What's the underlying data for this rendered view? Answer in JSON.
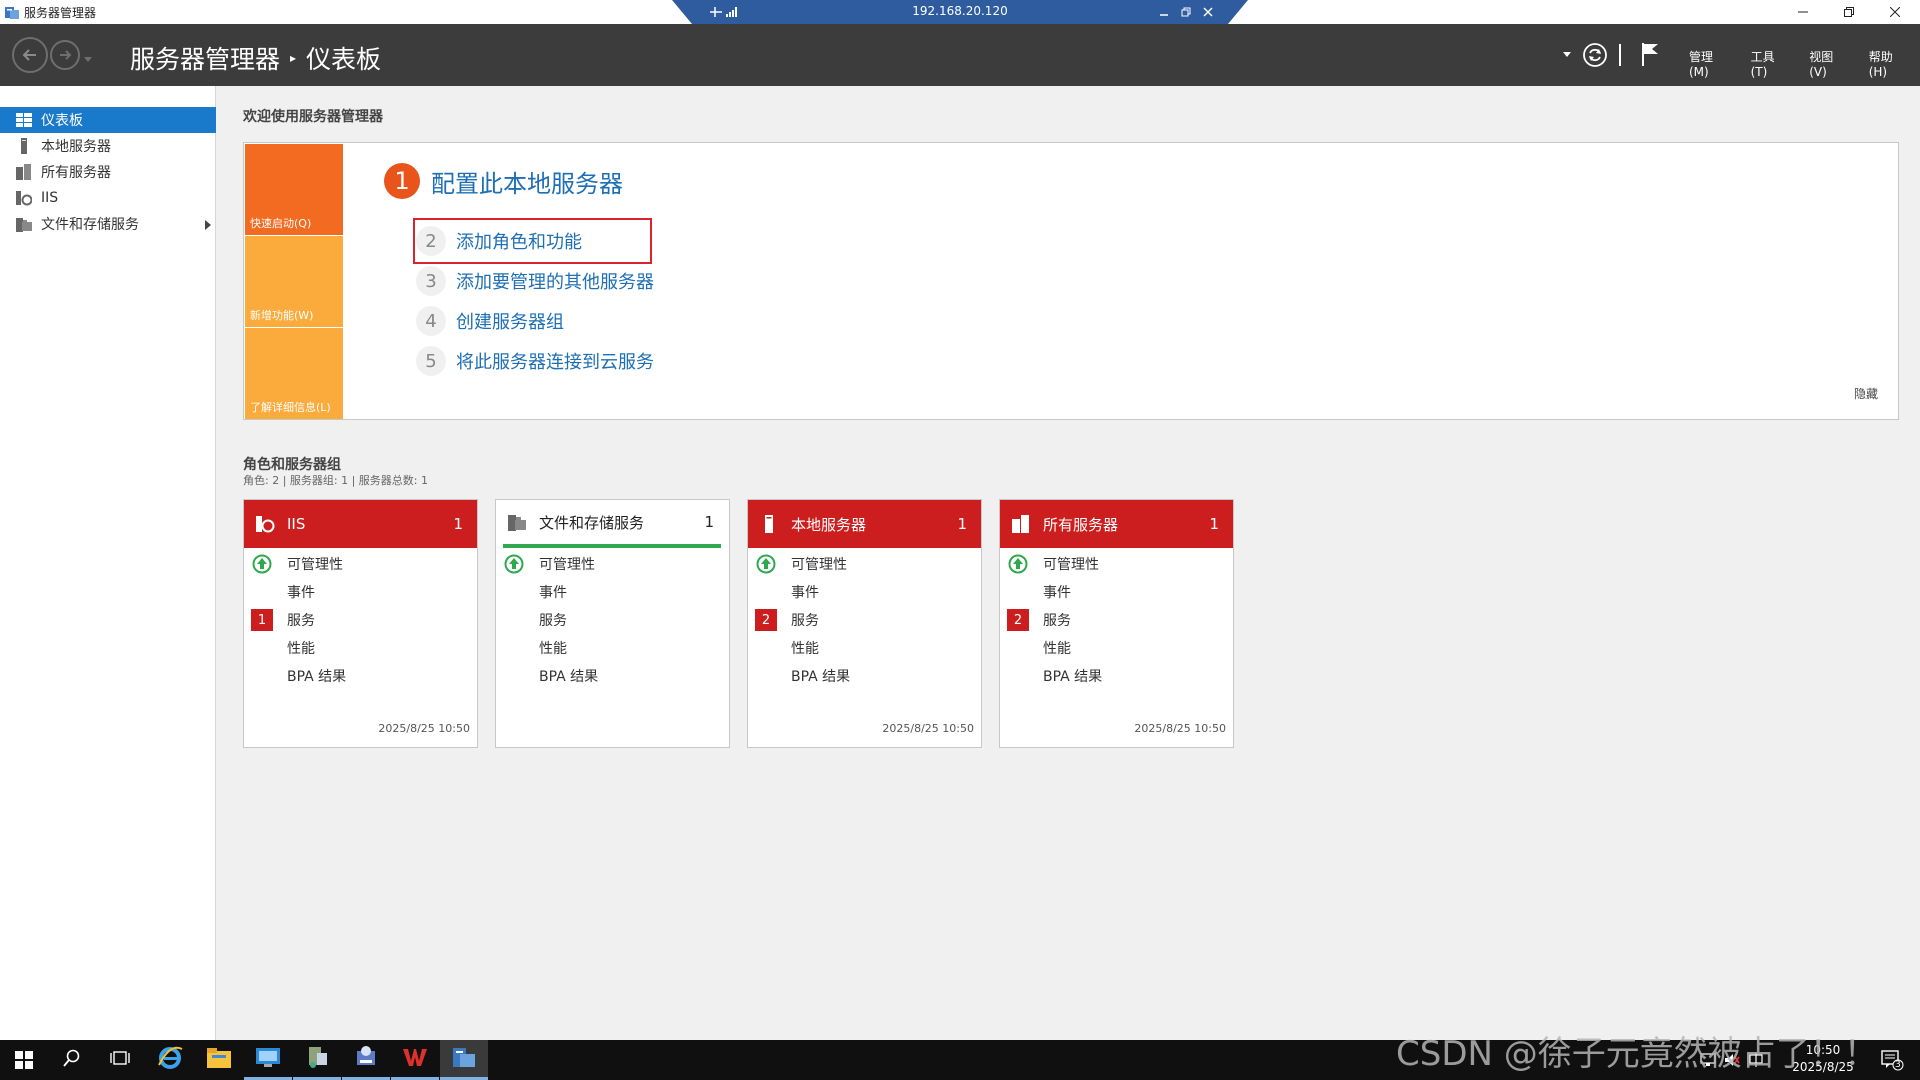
{
  "window": {
    "title": "服务器管理器",
    "rdp_host": "192.168.20.120"
  },
  "header": {
    "breadcrumb_app": "服务器管理器",
    "breadcrumb_page": "仪表板",
    "menu": [
      "管理(M)",
      "工具(T)",
      "视图(V)",
      "帮助(H)"
    ]
  },
  "sidebar": {
    "items": [
      {
        "label": "仪表板",
        "icon": "dashboard-icon",
        "active": true
      },
      {
        "label": "本地服务器",
        "icon": "local-server-icon",
        "active": false
      },
      {
        "label": "所有服务器",
        "icon": "all-servers-icon",
        "active": false
      },
      {
        "label": "IIS",
        "icon": "iis-icon",
        "active": false
      },
      {
        "label": "文件和存储服务",
        "icon": "file-storage-icon",
        "active": false,
        "has_arrow": true
      }
    ]
  },
  "welcome": {
    "title": "欢迎使用服务器管理器",
    "quick_tabs": [
      "快速启动(Q)",
      "新增功能(W)",
      "了解详细信息(L)"
    ],
    "step1_num": "1",
    "step1_label": "配置此本地服务器",
    "steps": [
      {
        "num": "2",
        "label": "添加角色和功能"
      },
      {
        "num": "3",
        "label": "添加要管理的其他服务器"
      },
      {
        "num": "4",
        "label": "创建服务器组"
      },
      {
        "num": "5",
        "label": "将此服务器连接到云服务"
      }
    ],
    "hide_label": "隐藏"
  },
  "roles": {
    "title": "角色和服务器组",
    "subtitle": "角色: 2 | 服务器组: 1 | 服务器总数: 1",
    "row_labels": [
      "可管理性",
      "事件",
      "服务",
      "性能",
      "BPA 结果"
    ],
    "tiles": [
      {
        "name": "IIS",
        "count": "1",
        "status": "red",
        "services_badge": "1",
        "timestamp": "2025/8/25 10:50"
      },
      {
        "name": "文件和存储服务",
        "count": "1",
        "status": "ok",
        "services_badge": "",
        "timestamp": ""
      },
      {
        "name": "本地服务器",
        "count": "1",
        "status": "red",
        "services_badge": "2",
        "timestamp": "2025/8/25 10:50"
      },
      {
        "name": "所有服务器",
        "count": "1",
        "status": "red",
        "services_badge": "2",
        "timestamp": "2025/8/25 10:50"
      }
    ]
  },
  "taskbar": {
    "time": "10:50",
    "date": "2025/8/25",
    "notification_count": "3"
  },
  "watermark": "CSDN @徐子元竟然被占了！！",
  "colors": {
    "header_bg": "#3c3c3c",
    "accent_blue": "#1979ca",
    "alert_red": "#cc1e1e",
    "quick_orange": "#f26b21",
    "ok_green": "#2fa84f"
  }
}
